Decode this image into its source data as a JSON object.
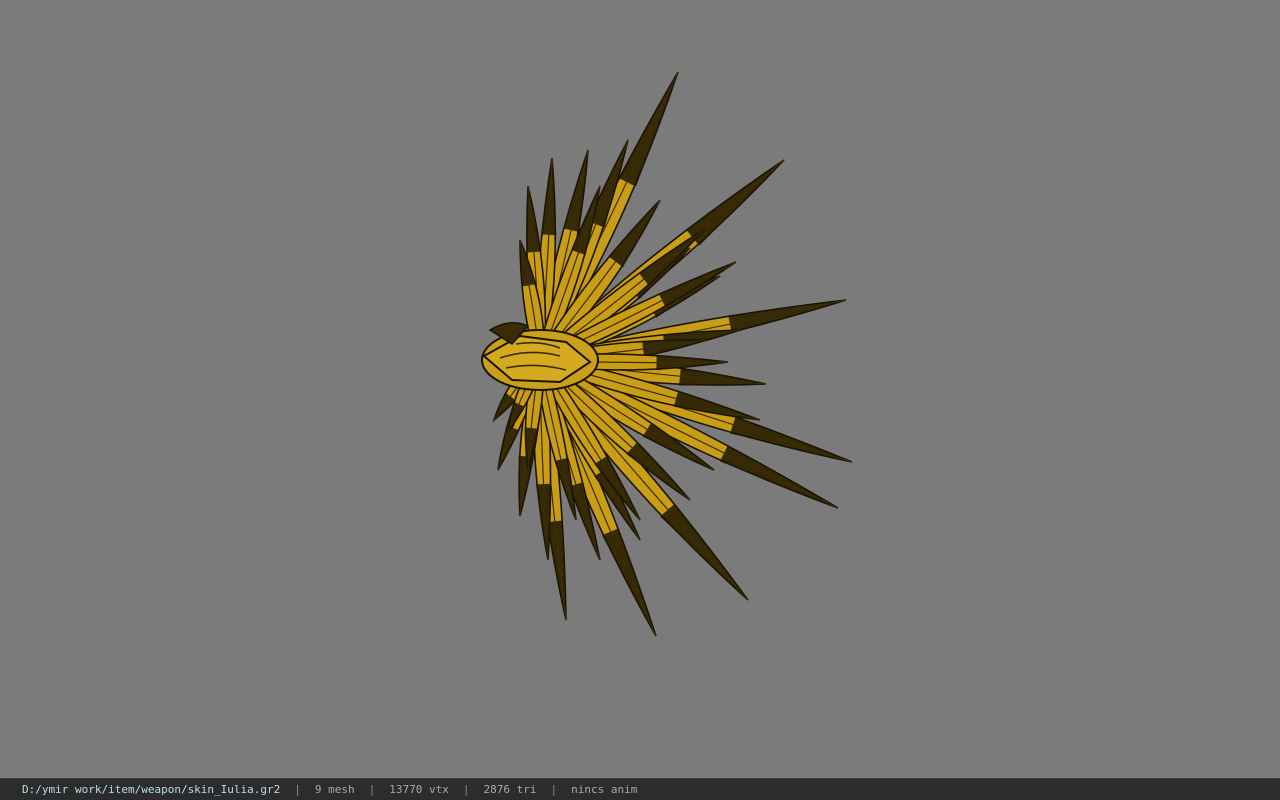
{
  "viewport": {
    "background": "#7b7b7b",
    "model": "golden-wing-model",
    "model_colors": {
      "gold": "#c79a14",
      "gold_light": "#e0b526",
      "dark": "#1a1404"
    }
  },
  "status_bar": {
    "file_path": "D:/ymir work/item/weapon/skin_Iulia.gr2",
    "separator": "|",
    "mesh_count": "9 mesh",
    "vertex_count": "13770 vtx",
    "triangle_count": "2876 tri",
    "anim_status": "nincs anim"
  }
}
